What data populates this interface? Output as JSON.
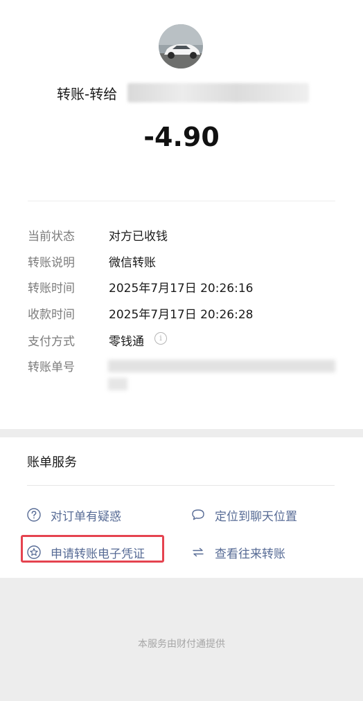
{
  "header": {
    "avatar_icon": "car-avatar-icon",
    "title_prefix": "转账-转给",
    "amount": "-4.90"
  },
  "details": [
    {
      "label": "当前状态",
      "value": "对方已收钱"
    },
    {
      "label": "转账说明",
      "value": "微信转账"
    },
    {
      "label": "转账时间",
      "value": "2025年7月17日 20:26:16"
    },
    {
      "label": "收款时间",
      "value": "2025年7月17日 20:26:28"
    },
    {
      "label": "支付方式",
      "value": "零钱通"
    },
    {
      "label": "转账单号",
      "value": ""
    }
  ],
  "services": {
    "title": "账单服务",
    "items": [
      {
        "label": "对订单有疑惑",
        "icon": "question-circle-icon"
      },
      {
        "label": "定位到聊天位置",
        "icon": "chat-bubble-icon"
      },
      {
        "label": "申请转账电子凭证",
        "icon": "star-circle-icon"
      },
      {
        "label": "查看往来转账",
        "icon": "swap-arrows-icon"
      }
    ]
  },
  "footer": "本服务由财付通提供",
  "colors": {
    "link": "#576b95",
    "highlight": "#e5434f",
    "background": "#ededed"
  }
}
